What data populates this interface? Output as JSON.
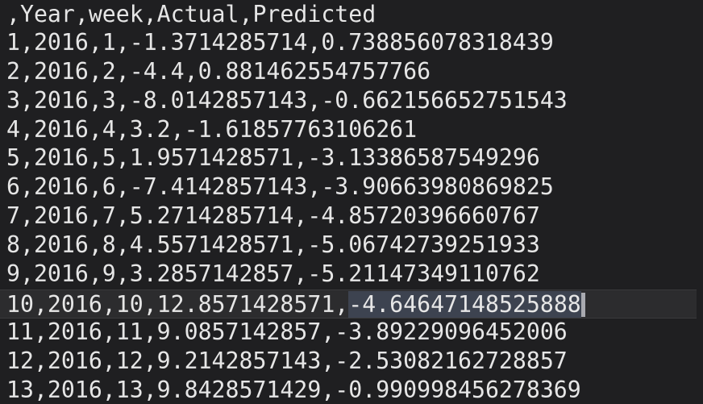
{
  "editor": {
    "lines": [
      ",Year,week,Actual,Predicted",
      "1,2016,1,-1.3714285714,0.738856078318439",
      "2,2016,2,-4.4,0.881462554757766",
      "3,2016,3,-8.0142857143,-0.662156652751543",
      "4,2016,4,3.2,-1.61857763106261",
      "5,2016,5,1.9571428571,-3.13386587549296",
      "6,2016,6,-7.4142857143,-3.90663980869825",
      "7,2016,7,5.2714285714,-4.85720396660767",
      "8,2016,8,4.5571428571,-5.06742739251933",
      "9,2016,9,3.2857142857,-5.21147349110762",
      "11,2016,11,9.0857142857,-3.89229096452006",
      "12,2016,12,9.2142857143,-2.53082162728857",
      "13,2016,13,9.8428571429,-0.990998456278369"
    ],
    "current_line": {
      "prefix": "10,2016,10,12.8571428571,",
      "selected": "-4.64647148525888"
    }
  }
}
